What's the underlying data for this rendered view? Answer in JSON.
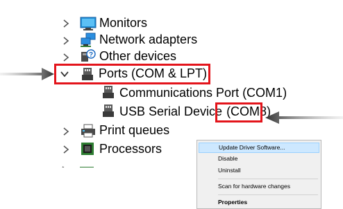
{
  "tree": {
    "items": [
      {
        "label": "Monitors",
        "expanded": false
      },
      {
        "label": "Network adapters",
        "expanded": false
      },
      {
        "label": "Other devices",
        "expanded": false
      },
      {
        "label": "Ports (COM & LPT)",
        "expanded": true
      },
      {
        "label": "Communications Port (COM1)"
      },
      {
        "label": "USB Serial Device (COM8)"
      },
      {
        "label": "Print queues",
        "expanded": false
      },
      {
        "label": "Processors",
        "expanded": false
      }
    ]
  },
  "usb_device": {
    "name": "USB Serial Device ",
    "port": "(COM8)"
  },
  "context_menu": {
    "items": [
      {
        "label": "Update Driver Software...",
        "highlighted": true
      },
      {
        "label": "Disable"
      },
      {
        "label": "Uninstall"
      },
      {
        "label": "Scan for hardware changes"
      },
      {
        "label": "Properties",
        "bold": true
      }
    ]
  },
  "colors": {
    "highlight_box": "#e3141b",
    "arrow": "#333333",
    "menu_highlight": "#cde8ff"
  }
}
